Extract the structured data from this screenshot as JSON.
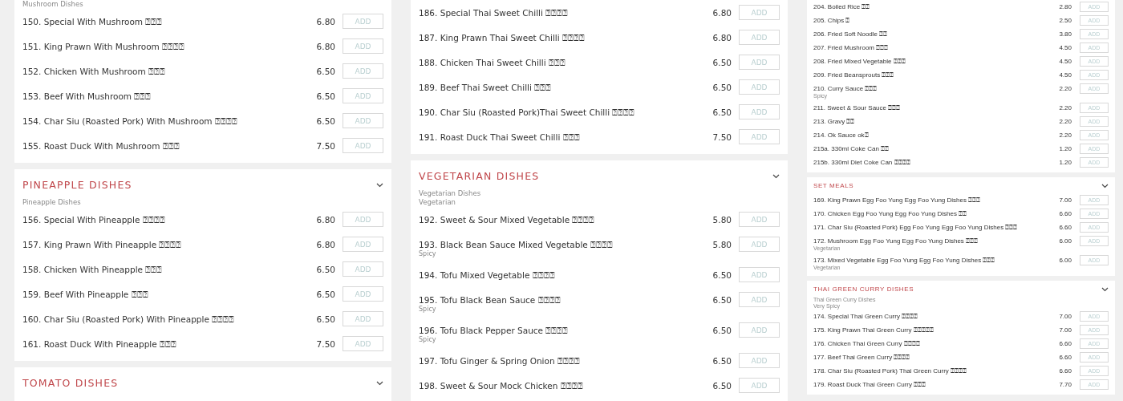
{
  "columns": [
    {
      "sections": [
        {
          "subtitles": [
            "Mushroom Dishes"
          ],
          "items": [
            {
              "name": "150. Special With Mushroom ⍰⍰⍰",
              "price": "6.80",
              "button": "ADD"
            },
            {
              "name": "151. King Prawn With Mushroom ⍰⍰⍰⍰",
              "price": "6.80",
              "button": "ADD"
            },
            {
              "name": "152. Chicken With Mushroom ⍰⍰⍰",
              "price": "6.50",
              "button": "ADD"
            },
            {
              "name": "153. Beef With Mushroom ⍰⍰⍰",
              "price": "6.50",
              "button": "ADD"
            },
            {
              "name": "154. Char Siu (Roasted Pork) With Mushroom ⍰⍰⍰⍰",
              "price": "6.50",
              "button": "ADD"
            },
            {
              "name": "155. Roast Duck With Mushroom ⍰⍰⍰",
              "price": "7.50",
              "button": "ADD"
            }
          ]
        },
        {
          "title": "PINEAPPLE DISHES",
          "subtitles": [
            "Pineapple Dishes"
          ],
          "items": [
            {
              "name": "156. Special With Pineapple ⍰⍰⍰⍰",
              "price": "6.80",
              "button": "ADD"
            },
            {
              "name": "157. King Prawn With Pineapple ⍰⍰⍰⍰",
              "price": "6.80",
              "button": "ADD"
            },
            {
              "name": "158. Chicken With Pineapple ⍰⍰⍰",
              "price": "6.50",
              "button": "ADD"
            },
            {
              "name": "159. Beef With Pineapple ⍰⍰⍰",
              "price": "6.50",
              "button": "ADD"
            },
            {
              "name": "160. Char Siu (Roasted Pork) With Pineapple ⍰⍰⍰⍰",
              "price": "6.50",
              "button": "ADD"
            },
            {
              "name": "161. Roast Duck With Pineapple ⍰⍰⍰",
              "price": "7.50",
              "button": "ADD"
            }
          ]
        },
        {
          "title": "TOMATO DISHES"
        }
      ]
    },
    {
      "sections": [
        {
          "items": [
            {
              "name": "186. Special Thai Sweet Chilli ⍰⍰⍰⍰",
              "price": "6.80",
              "button": "ADD"
            },
            {
              "name": "187. King Prawn Thai Sweet Chilli ⍰⍰⍰⍰",
              "price": "6.80",
              "button": "ADD"
            },
            {
              "name": "188. Chicken Thai Sweet Chilli ⍰⍰⍰",
              "price": "6.50",
              "button": "ADD"
            },
            {
              "name": "189. Beef Thai Sweet Chilli ⍰⍰⍰",
              "price": "6.50",
              "button": "ADD"
            },
            {
              "name": "190. Char Siu (Roasted Pork)Thai Sweet Chilli ⍰⍰⍰⍰",
              "price": "6.50",
              "button": "ADD"
            },
            {
              "name": "191. Roast Duck Thai Sweet Chilli ⍰⍰⍰",
              "price": "7.50",
              "button": "ADD"
            }
          ]
        },
        {
          "title": "VEGETARIAN DISHES",
          "subtitles": [
            "Vegetarian Dishes",
            "Vegetarian"
          ],
          "items": [
            {
              "name": "192. Sweet & Sour Mixed Vegetable ⍰⍰⍰⍰",
              "price": "5.80",
              "button": "ADD"
            },
            {
              "name": "193. Black Bean Sauce Mixed Vegetable ⍰⍰⍰⍰",
              "note": "Spicy",
              "price": "5.80",
              "button": "ADD"
            },
            {
              "name": "194. Tofu Mixed Vegetable ⍰⍰⍰⍰",
              "price": "6.50",
              "button": "ADD"
            },
            {
              "name": "195. Tofu Black Bean Sauce ⍰⍰⍰⍰",
              "note": "Spicy",
              "price": "6.50",
              "button": "ADD"
            },
            {
              "name": "196. Tofu Black Pepper Sauce ⍰⍰⍰⍰",
              "note": "Spicy",
              "price": "6.50",
              "button": "ADD"
            },
            {
              "name": "197. Tofu Ginger & Spring Onion ⍰⍰⍰⍰",
              "price": "6.50",
              "button": "ADD"
            },
            {
              "name": "198. Sweet & Sour Mock Chicken ⍰⍰⍰⍰",
              "price": "6.50",
              "button": "ADD"
            }
          ]
        }
      ]
    },
    {
      "sections": [
        {
          "items": [
            {
              "name": "204. Boiled Rice ⍰⍰",
              "price": "2.80",
              "button": "ADD"
            },
            {
              "name": "205. Chips ⍰",
              "price": "2.50",
              "button": "ADD"
            },
            {
              "name": "206. Fried Soft Noodle ⍰⍰",
              "price": "3.80",
              "button": "ADD"
            },
            {
              "name": "207. Fried Mushroom ⍰⍰⍰",
              "price": "4.50",
              "button": "ADD"
            },
            {
              "name": "208. Fried Mixed Vegetable ⍰⍰⍰",
              "price": "4.50",
              "button": "ADD"
            },
            {
              "name": "209. Fried Beansprouts ⍰⍰⍰",
              "price": "4.50",
              "button": "ADD"
            },
            {
              "name": "210. Curry Sauce ⍰⍰⍰",
              "note": "Spicy",
              "price": "2.20",
              "button": "ADD"
            },
            {
              "name": "211. Sweet & Sour Sauce ⍰⍰⍰",
              "price": "2.20",
              "button": "ADD"
            },
            {
              "name": "213. Gravy ⍰⍰",
              "price": "2.20",
              "button": "ADD"
            },
            {
              "name": "214. Ok Sauce ok⍰",
              "price": "2.20",
              "button": "ADD"
            },
            {
              "name": "215a. 330ml Coke Can ⍰⍰",
              "price": "1.20",
              "button": "ADD"
            },
            {
              "name": "215b. 330ml Diet Coke Can ⍰⍰⍰⍰",
              "price": "1.20",
              "button": "ADD"
            }
          ]
        },
        {
          "title": "SET MEALS",
          "items": [
            {
              "name": "169. King Prawn Egg Foo Yung Egg Foo Yung Dishes ⍰⍰⍰",
              "price": "7.00",
              "button": "ADD"
            },
            {
              "name": "170. Chicken Egg Foo Yung Egg Foo Yung Dishes ⍰⍰",
              "price": "6.60",
              "button": "ADD"
            },
            {
              "name": "171. Char Siu (Roasted Pork) Egg Foo Yung Egg Foo Yung Dishes ⍰⍰⍰",
              "price": "6.60",
              "button": "ADD"
            },
            {
              "name": "172. Mushroom Egg Foo Yung Egg Foo Yung Dishes ⍰⍰⍰",
              "note": "Vegetarian",
              "price": "6.00",
              "button": "ADD"
            },
            {
              "name": "173. Mixed Vegetable Egg Foo Yung Egg Foo Yung Dishes ⍰⍰⍰",
              "note": "Vegetarian",
              "price": "6.00",
              "button": "ADD"
            }
          ]
        },
        {
          "title": "THAI GREEN CURRY DISHES",
          "subtitles": [
            "Thai Green Curry Dishes",
            "Very Spicy"
          ],
          "items": [
            {
              "name": "174. Special Thai Green Curry ⍰⍰⍰⍰",
              "price": "7.00",
              "button": "ADD"
            },
            {
              "name": "175. King Prawn Thai Green Curry ⍰⍰⍰⍰⍰",
              "price": "7.00",
              "button": "ADD"
            },
            {
              "name": "176. Chicken Thai Green Curry ⍰⍰⍰⍰",
              "price": "6.60",
              "button": "ADD"
            },
            {
              "name": "177. Beef Thai Green Curry ⍰⍰⍰⍰",
              "price": "6.60",
              "button": "ADD"
            },
            {
              "name": "178. Char Siu (Roasted Pork) Thai Green Curry ⍰⍰⍰⍰",
              "price": "6.60",
              "button": "ADD"
            },
            {
              "name": "179. Roast Duck Thai Green Curry ⍰⍰⍰",
              "price": "7.70",
              "button": "ADD"
            }
          ]
        }
      ]
    }
  ]
}
